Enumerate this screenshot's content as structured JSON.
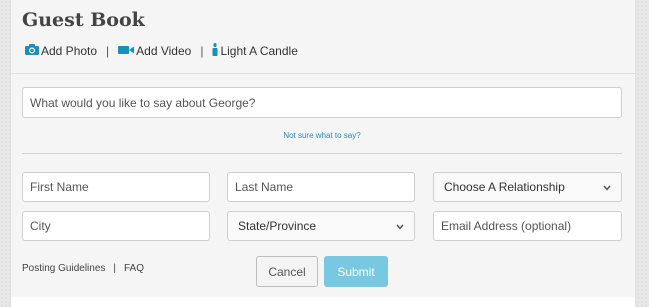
{
  "guestbook": {
    "title": "Guest Book",
    "actions": {
      "add_photo": "Add Photo",
      "add_video": "Add Video",
      "light_candle": "Light A Candle",
      "separator": "|"
    },
    "message_placeholder": "What would you like to say about George?",
    "help_link": "Not sure what to say?",
    "fields": {
      "first_name": "First Name",
      "last_name": "Last Name",
      "relationship": "Choose A Relationship",
      "city": "City",
      "state": "State/Province",
      "email": "Email Address (optional)"
    },
    "footer": {
      "posting_guidelines": "Posting Guidelines",
      "separator": "|",
      "faq": "FAQ"
    },
    "buttons": {
      "cancel": "Cancel",
      "submit": "Submit"
    },
    "colors": {
      "accent": "#1a8fb8",
      "submit_bg": "#79c8e2",
      "link": "#2a8ab0"
    },
    "icons": {
      "photo": "camera-icon",
      "video": "video-camera-icon",
      "candle": "candle-icon",
      "dropdown": "chevron-down-icon"
    }
  }
}
